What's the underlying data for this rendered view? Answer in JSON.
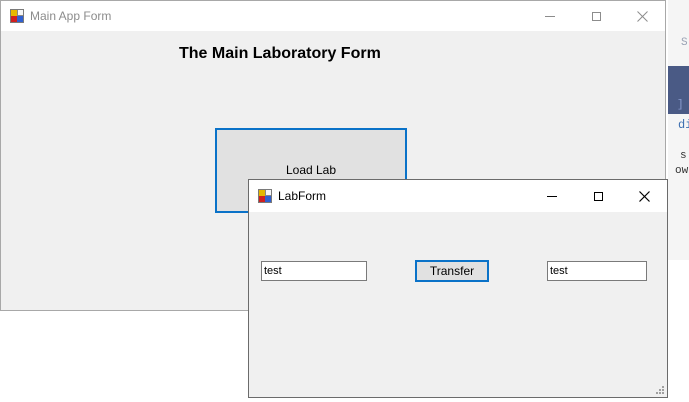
{
  "main_window": {
    "title": "Main App Form",
    "heading": "The Main Laboratory Form",
    "load_button_label": "Load Lab",
    "minimize_glyph": "minimize-icon",
    "maximize_glyph": "maximize-icon",
    "close_glyph": "close-icon"
  },
  "lab_window": {
    "title": "LabForm",
    "left_textbox_value": "test",
    "transfer_button_label": "Transfer",
    "right_textbox_value": "test",
    "minimize_glyph": "minimize-icon",
    "maximize_glyph": "maximize-icon",
    "close_glyph": "close-icon"
  },
  "colors": {
    "window_background": "#f0f0f0",
    "titlebar_background": "#ffffff",
    "focus_border": "#0a72c8",
    "inactive_title_text": "#8c8c8c"
  }
}
